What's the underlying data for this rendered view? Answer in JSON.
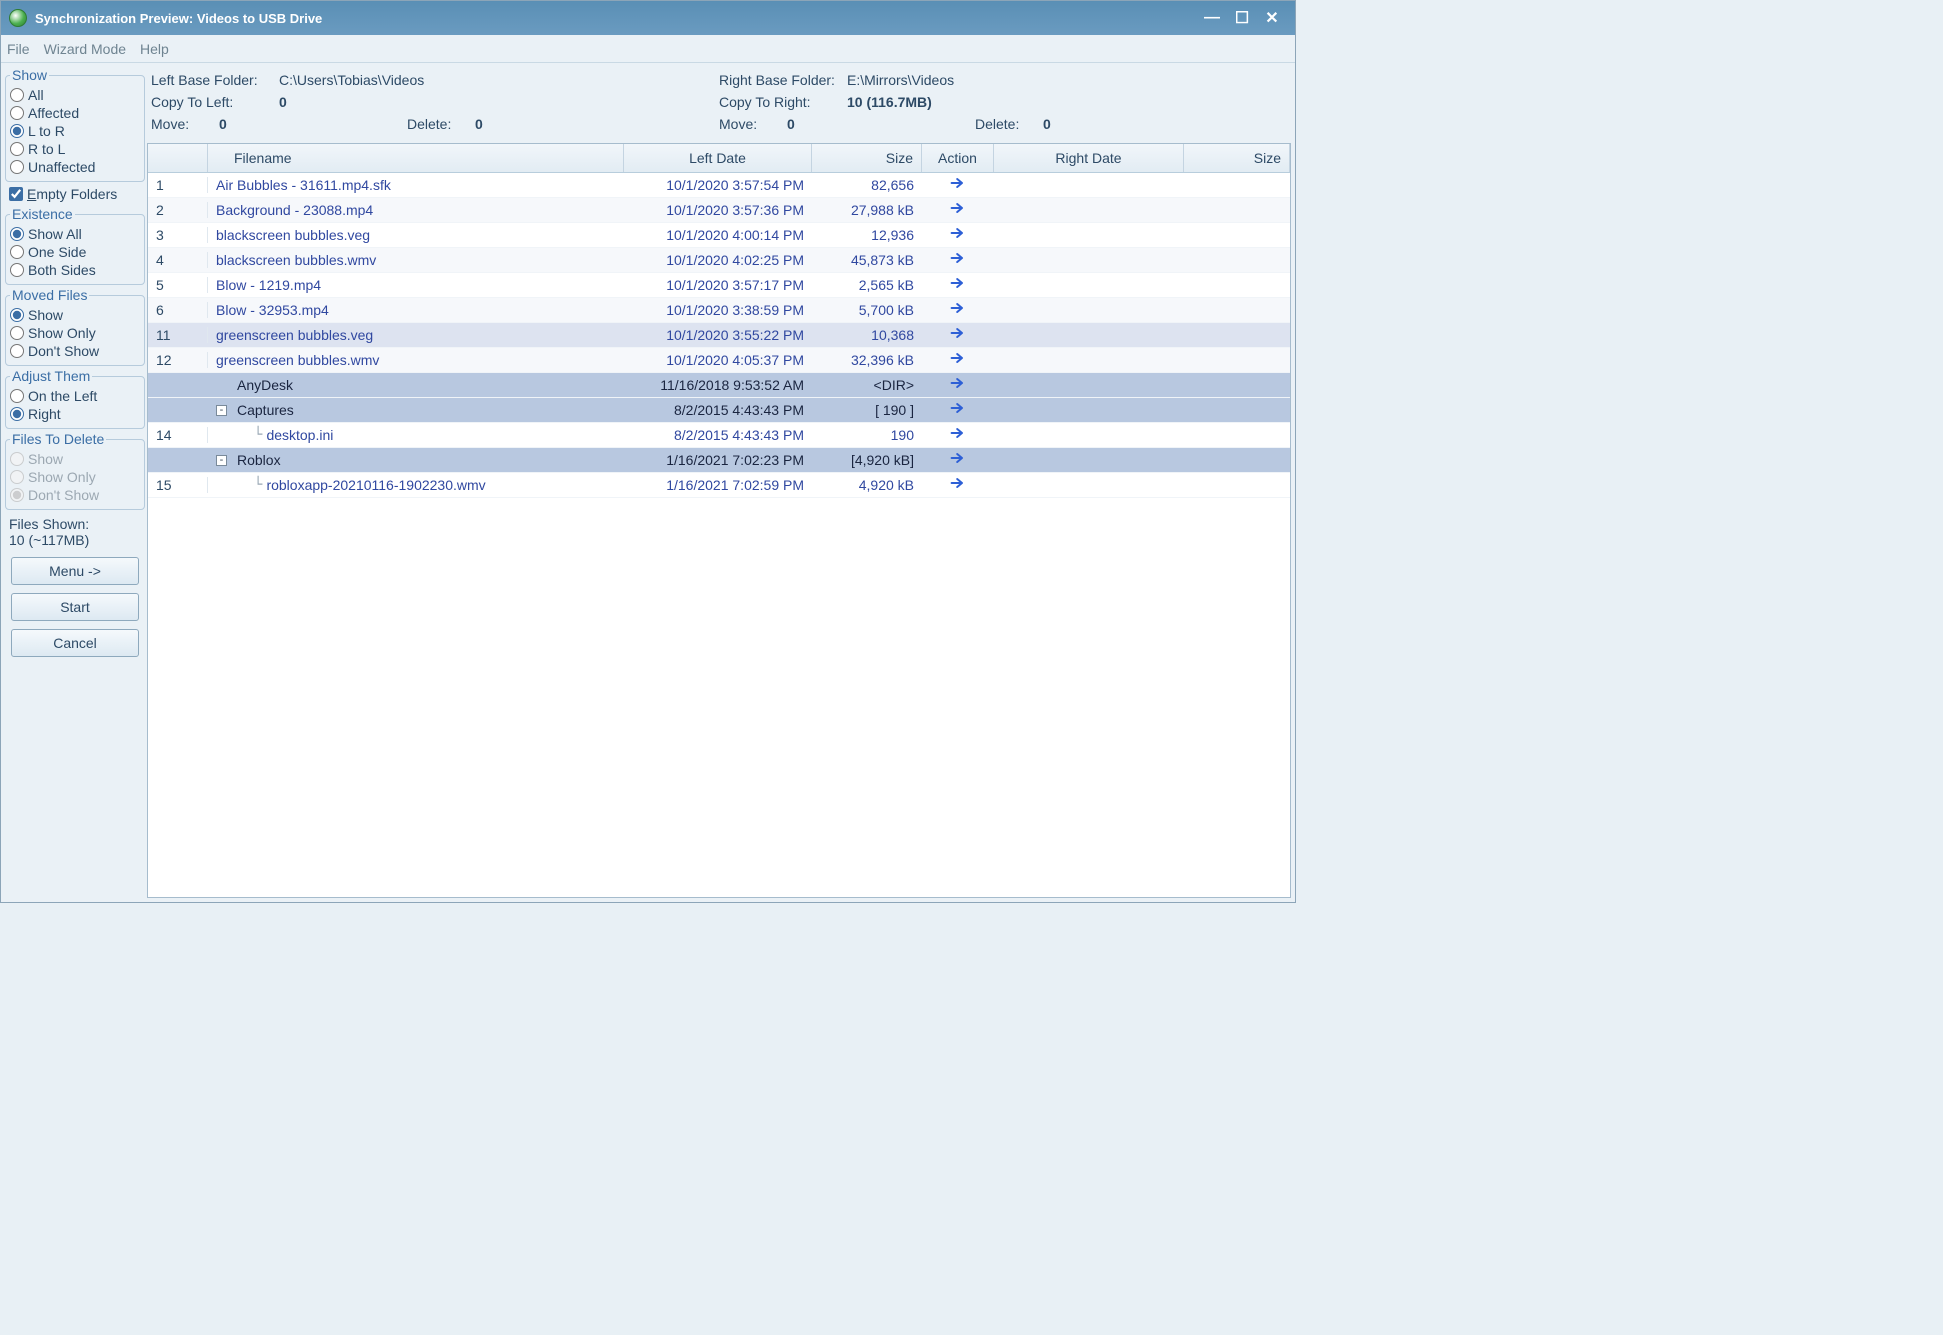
{
  "window_title": "Synchronization Preview: Videos to USB Drive",
  "menubar": [
    "File",
    "Wizard Mode",
    "Help"
  ],
  "sidebar": {
    "show": {
      "legend": "Show",
      "options": [
        "All",
        "Affected",
        "L to R",
        "R to L",
        "Unaffected"
      ],
      "selected_index": 2
    },
    "empty_folders_label": "Empty Folders",
    "empty_folders_checked": true,
    "existence": {
      "legend": "Existence",
      "options": [
        "Show All",
        "One Side",
        "Both Sides"
      ],
      "selected_index": 0
    },
    "moved_files": {
      "legend": "Moved Files",
      "options": [
        "Show",
        "Show Only",
        "Don't Show"
      ],
      "selected_index": 0
    },
    "adjust_them": {
      "legend": "Adjust Them",
      "options": [
        "On the Left",
        "Right"
      ],
      "selected_index": 1
    },
    "files_to_delete": {
      "legend": "Files To Delete",
      "options": [
        "Show",
        "Show Only",
        "Don't Show"
      ],
      "selected_index": 2,
      "disabled": true
    },
    "files_shown_label": "Files Shown:",
    "files_shown_value": "10 (~117MB)",
    "buttons": {
      "menu": "Menu ->",
      "start": "Start",
      "cancel": "Cancel"
    }
  },
  "info": {
    "left": {
      "base_folder_label": "Left Base Folder:",
      "base_folder_value": "C:\\Users\\Tobias\\Videos",
      "copy_to_label": "Copy To Left:",
      "copy_to_value": "0",
      "move_label": "Move:",
      "move_value": "0",
      "delete_label": "Delete:",
      "delete_value": "0"
    },
    "right": {
      "base_folder_label": "Right Base Folder:",
      "base_folder_value": "E:\\Mirrors\\Videos",
      "copy_to_label": "Copy To Right:",
      "copy_to_value": "10 (116.7MB)",
      "move_label": "Move:",
      "move_value": "0",
      "delete_label": "Delete:",
      "delete_value": "0"
    }
  },
  "columns": {
    "filename": "Filename",
    "left_date": "Left Date",
    "size_left": "Size",
    "action": "Action",
    "right_date": "Right Date",
    "size_right": "Size"
  },
  "rows": [
    {
      "num": "1",
      "name": "Air Bubbles - 31611.mp4.sfk",
      "ldate": "10/1/2020 3:57:54 PM",
      "size": "82,656",
      "type": "file",
      "alt": false
    },
    {
      "num": "2",
      "name": "Background - 23088.mp4",
      "ldate": "10/1/2020 3:57:36 PM",
      "size": "27,988 kB",
      "type": "file",
      "alt": true
    },
    {
      "num": "3",
      "name": "blackscreen bubbles.veg",
      "ldate": "10/1/2020 4:00:14 PM",
      "size": "12,936",
      "type": "file",
      "alt": false
    },
    {
      "num": "4",
      "name": "blackscreen bubbles.wmv",
      "ldate": "10/1/2020 4:02:25 PM",
      "size": "45,873 kB",
      "type": "file",
      "alt": true
    },
    {
      "num": "5",
      "name": "Blow - 1219.mp4",
      "ldate": "10/1/2020 3:57:17 PM",
      "size": "2,565 kB",
      "type": "file",
      "alt": false
    },
    {
      "num": "6",
      "name": "Blow - 32953.mp4",
      "ldate": "10/1/2020 3:38:59 PM",
      "size": "5,700 kB",
      "type": "file",
      "alt": true
    },
    {
      "num": "11",
      "name": "greenscreen bubbles.veg",
      "ldate": "10/1/2020 3:55:22 PM",
      "size": "10,368",
      "type": "file",
      "sel": true
    },
    {
      "num": "12",
      "name": "greenscreen bubbles.wmv",
      "ldate": "10/1/2020 4:05:37 PM",
      "size": "32,396 kB",
      "type": "file",
      "alt": true
    },
    {
      "num": "",
      "name": "AnyDesk",
      "ldate": "11/16/2018 9:53:52 AM",
      "size": "<DIR>",
      "type": "dir",
      "indent": 0,
      "expander": ""
    },
    {
      "num": "",
      "name": "Captures",
      "ldate": "8/2/2015 4:43:43 PM",
      "size": "[  190  ]",
      "type": "dir",
      "indent": 0,
      "expander": "-"
    },
    {
      "num": "14",
      "name": "desktop.ini",
      "ldate": "8/2/2015 4:43:43 PM",
      "size": "190",
      "type": "child",
      "indent": 1
    },
    {
      "num": "",
      "name": "Roblox",
      "ldate": "1/16/2021 7:02:23 PM",
      "size": "[4,920 kB]",
      "type": "dir",
      "indent": 0,
      "expander": "-"
    },
    {
      "num": "15",
      "name": "robloxapp-20210116-1902230.wmv",
      "ldate": "1/16/2021 7:02:59 PM",
      "size": "4,920 kB",
      "type": "child",
      "indent": 1
    }
  ]
}
